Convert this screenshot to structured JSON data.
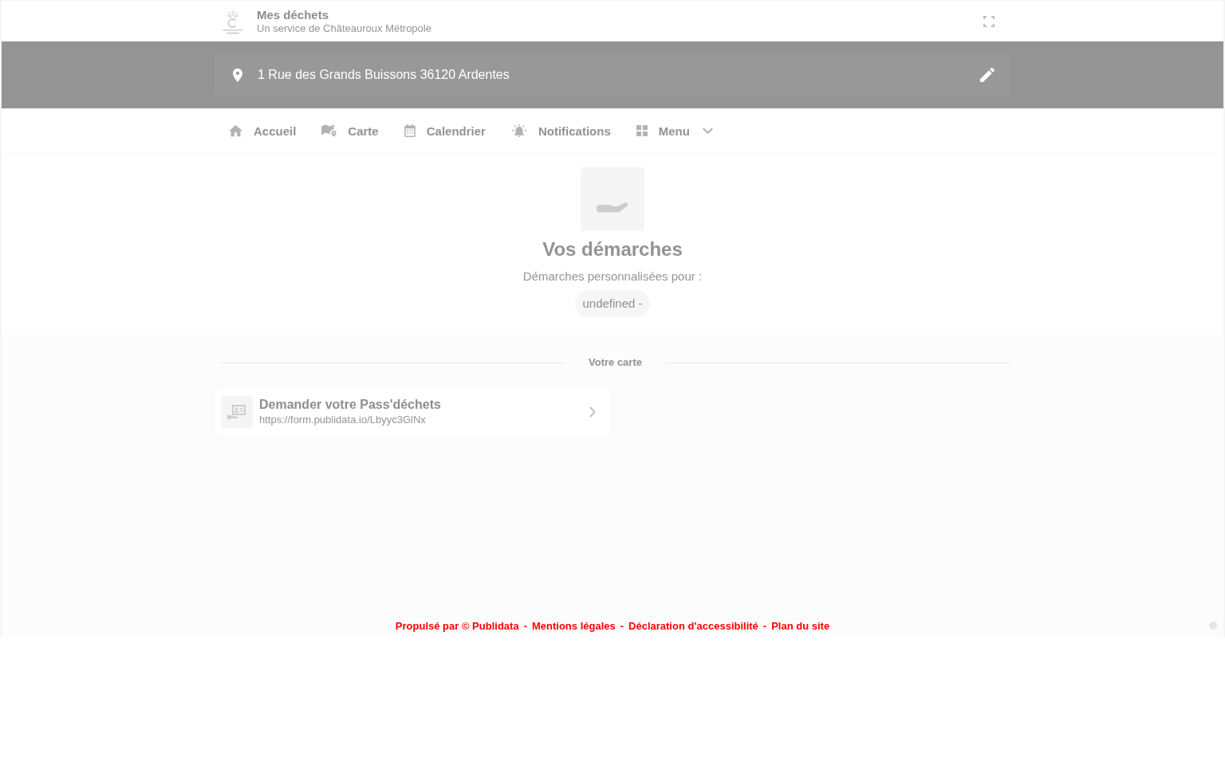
{
  "header": {
    "title": "Mes déchets",
    "subtitle": "Un service de Châteauroux Métropole"
  },
  "address": {
    "value": "1 Rue des Grands Buissons 36120 Ardentes"
  },
  "nav": [
    {
      "label": "Accueil",
      "kind": "home",
      "selected": false
    },
    {
      "label": "Carte",
      "kind": "map",
      "selected": false
    },
    {
      "label": "Calendrier",
      "kind": "calendar",
      "selected": false
    },
    {
      "label": "Notifications",
      "kind": "alert",
      "selected": false
    },
    {
      "label": "Menu",
      "kind": "grid",
      "selected": false,
      "dropdown": true
    }
  ],
  "procedures": {
    "title": "Vos démarches",
    "subtitle": "Démarches personnalisées pour :",
    "tag": "undefined -"
  },
  "section": {
    "heading": "Votre carte",
    "links": [
      {
        "title": "Demander votre Pass'déchets",
        "url": "https://form.publidata.io/Lbyyc3GlNx"
      }
    ]
  },
  "footer": {
    "links": [
      "Propulsé par © Publidata",
      "Mentions légales",
      "Déclaration d'accessibilité",
      "Plan du site"
    ],
    "separator": "-"
  }
}
